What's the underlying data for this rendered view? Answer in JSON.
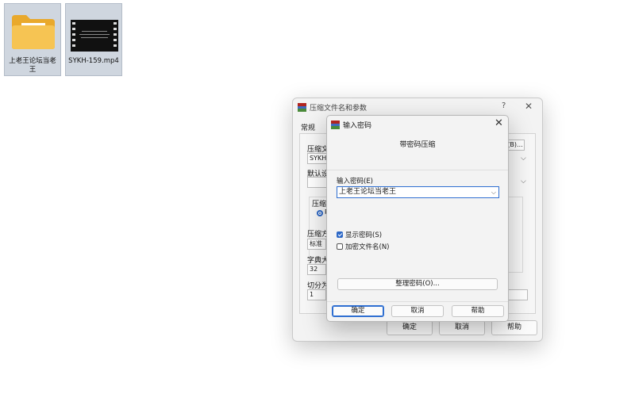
{
  "desktop": {
    "folder_label": "上老王论坛当老王",
    "video_label": "SYKH-159.mp4"
  },
  "bg_dialog": {
    "title": "压缩文件名和参数",
    "help_glyph": "?",
    "close_glyph": "✕",
    "tab": "常规",
    "fields": {
      "archive_name_label": "压缩文",
      "archive_name_value": "SYKH-",
      "browse_button": "(B)...",
      "default_profile_label": "默认设",
      "compress_group_label": "压缩",
      "radio_label": "R",
      "method_label": "压缩方",
      "method_value": "标准",
      "dict_label": "字典大",
      "dict_value": "32",
      "split_label": "切分为",
      "split_value": "1"
    },
    "buttons": {
      "ok": "确定",
      "cancel": "取消",
      "help": "帮助"
    }
  },
  "fg_dialog": {
    "title": "输入密码",
    "close_glyph": "✕",
    "header": "带密码压缩",
    "password_label": "输入密码(E)",
    "password_value": "上老王论坛当老王",
    "show_password": {
      "label": "显示密码(S)",
      "checked": true
    },
    "encrypt_names": {
      "label": "加密文件名(N)",
      "checked": false
    },
    "organize_button": "整理密码(O)...",
    "buttons": {
      "ok": "确定",
      "cancel": "取消",
      "help": "帮助"
    }
  },
  "colors": {
    "accent": "#2c67c6",
    "dialog_bg": "#f3f3f3",
    "folder": "#f4c04e"
  }
}
